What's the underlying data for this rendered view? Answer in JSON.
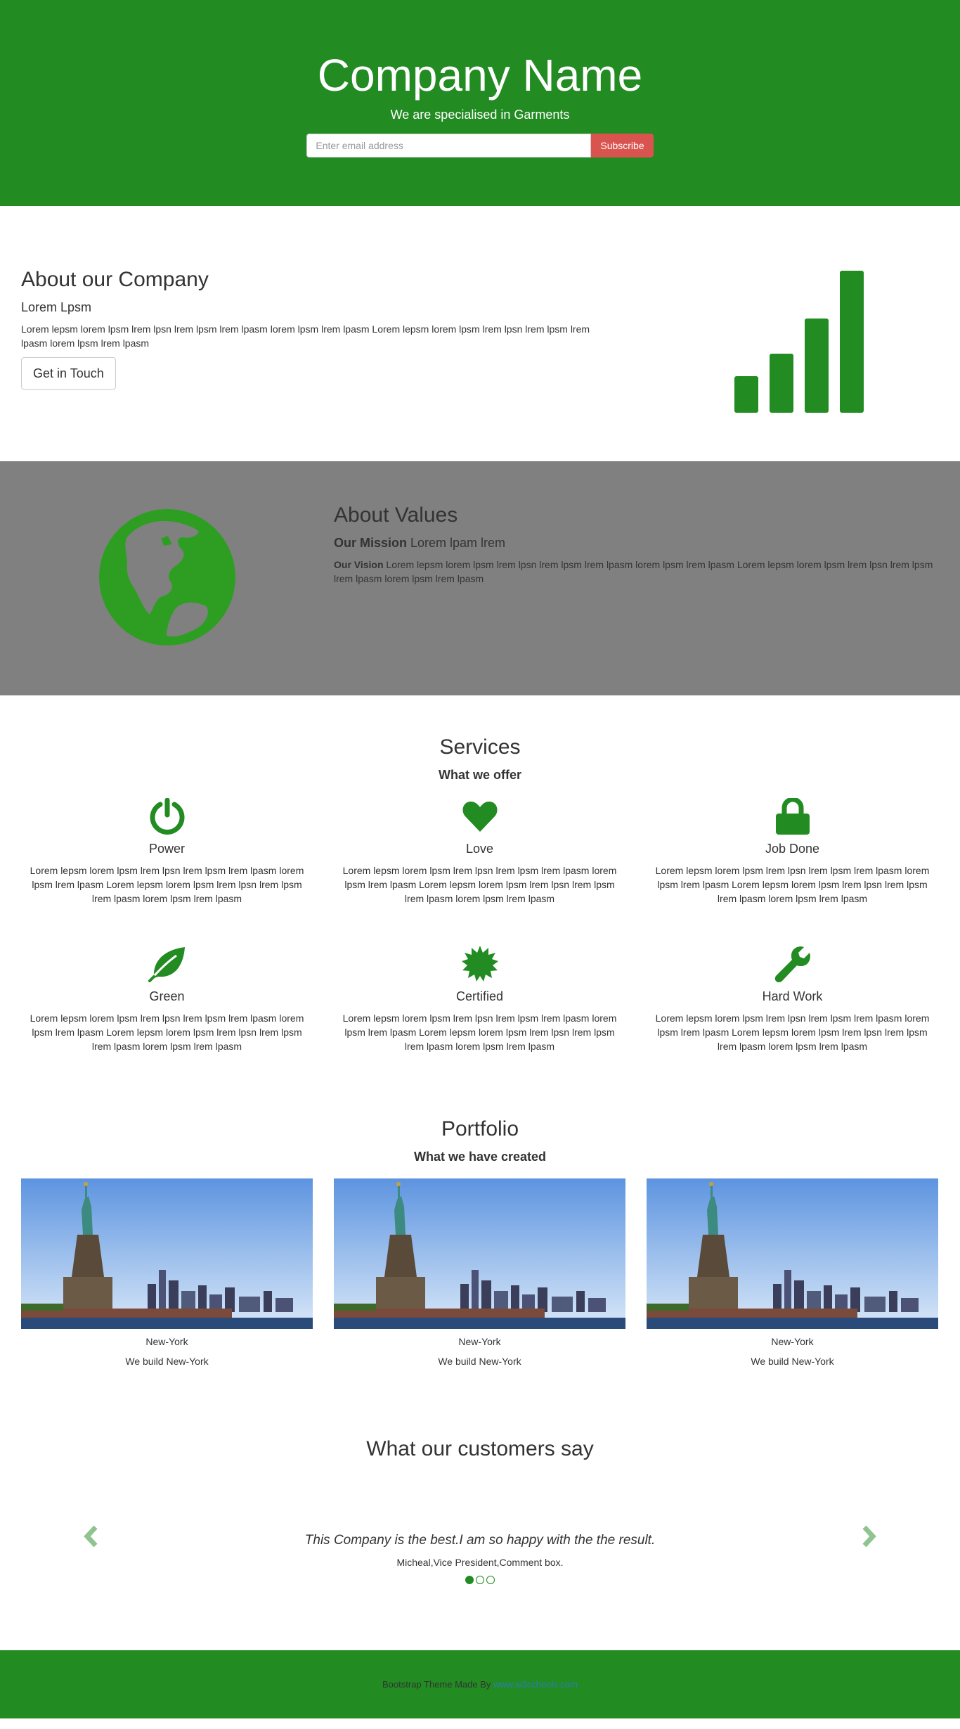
{
  "colors": {
    "brand": "#228b22",
    "danger": "#d9534f",
    "grey": "#808080"
  },
  "hero": {
    "title": "Company Name",
    "tagline": "We are specialised in Garments",
    "email_placeholder": "Enter email address",
    "subscribe_label": "Subscribe"
  },
  "about": {
    "title": "About our Company",
    "subtitle": "Lorem Lpsm",
    "body": "Lorem lepsm lorem lpsm lrem lpsn lrem lpsm lrem lpasm lorem lpsm lrem lpasm Lorem lepsm lorem lpsm lrem lpsn lrem lpsm lrem lpasm lorem lpsm lrem lpasm",
    "button_label": "Get in Touch",
    "icon": "signal-icon"
  },
  "values": {
    "title": "About Values",
    "mission_label": "Our Mission",
    "mission_text": " Lorem lpam lrem",
    "vision_label": "Our Vision",
    "vision_text": " Lorem lepsm lorem lpsm lrem lpsn lrem lpsm lrem lpasm lorem lpsm lrem lpasm Lorem lepsm lorem lpsm lrem lpsn lrem lpsm lrem lpasm lorem lpsm lrem lpasm",
    "icon": "globe-icon"
  },
  "services": {
    "title": "Services",
    "subtitle": "What we offer",
    "items": [
      {
        "label": "Power",
        "icon": "power-icon",
        "text": "Lorem lepsm lorem lpsm lrem lpsn lrem lpsm lrem lpasm lorem lpsm lrem lpasm Lorem lepsm lorem lpsm lrem lpsn lrem lpsm lrem lpasm lorem lpsm lrem lpasm"
      },
      {
        "label": "Love",
        "icon": "heart-icon",
        "text": "Lorem lepsm lorem lpsm lrem lpsn lrem lpsm lrem lpasm lorem lpsm lrem lpasm Lorem lepsm lorem lpsm lrem lpsn lrem lpsm lrem lpasm lorem lpsm lrem lpasm"
      },
      {
        "label": "Job Done",
        "icon": "lock-icon",
        "text": "Lorem lepsm lorem lpsm lrem lpsn lrem lpsm lrem lpasm lorem lpsm lrem lpasm Lorem lepsm lorem lpsm lrem lpsn lrem lpsm lrem lpasm lorem lpsm lrem lpasm"
      },
      {
        "label": "Green",
        "icon": "leaf-icon",
        "text": "Lorem lepsm lorem lpsm lrem lpsn lrem lpsm lrem lpasm lorem lpsm lrem lpasm Lorem lepsm lorem lpsm lrem lpsn lrem lpsm lrem lpasm lorem lpsm lrem lpasm"
      },
      {
        "label": "Certified",
        "icon": "certificate-icon",
        "text": "Lorem lepsm lorem lpsm lrem lpsn lrem lpsm lrem lpasm lorem lpsm lrem lpasm Lorem lepsm lorem lpsm lrem lpsn lrem lpsm lrem lpasm lorem lpsm lrem lpasm"
      },
      {
        "label": "Hard Work",
        "icon": "wrench-icon",
        "text": "Lorem lepsm lorem lpsm lrem lpsn lrem lpsm lrem lpasm lorem lpsm lrem lpasm Lorem lepsm lorem lpsm lrem lpsn lrem lpsm lrem lpasm lorem lpsm lrem lpasm"
      }
    ]
  },
  "portfolio": {
    "title": "Portfolio",
    "subtitle": "What we have created",
    "items": [
      {
        "title": "New-York",
        "caption": "We build New-York"
      },
      {
        "title": "New-York",
        "caption": "We build New-York"
      },
      {
        "title": "New-York",
        "caption": "We build New-York"
      }
    ]
  },
  "testimonials": {
    "title": "What our customers say",
    "quote": "This Company is the best.I am so happy with the the result.",
    "author": "Micheal,Vice President,Comment box.",
    "slide_count": 3,
    "active_slide": 1
  },
  "footer": {
    "text": "Bootstrap Theme Made By ",
    "link_text": "www.w3schools.com"
  }
}
